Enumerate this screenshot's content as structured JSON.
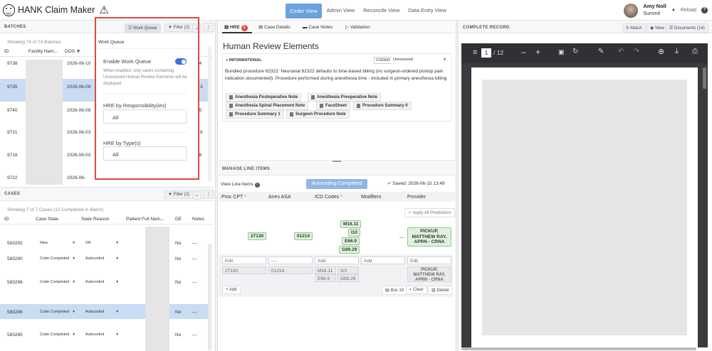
{
  "app": {
    "title": "HANK Claim Maker"
  },
  "nav": {
    "coder": "Coder View",
    "admin": "Admin View",
    "reconcile": "Reconcile View",
    "data_entry": "Data Entry View"
  },
  "user": {
    "name": "Amy Noll",
    "org": "Summit",
    "reload": "Reload",
    "help": "?"
  },
  "batches": {
    "header": "BATCHES",
    "work_queue_btn": "Work Queue",
    "filter_btn": "Filter (2)",
    "showing": "Showing 74 of 74 Batches",
    "columns": [
      "ID",
      "Facility Nam...",
      "DOS"
    ],
    "rows": [
      {
        "id": "9738",
        "dos": "2026-06-10",
        "side": "04"
      },
      {
        "id": "9735",
        "dos": "2026-06-09",
        "side": "3"
      },
      {
        "id": "9740",
        "dos": "2026-06-09",
        "side": "05"
      },
      {
        "id": "9721",
        "dos": "2026-06-03",
        "side": "8"
      },
      {
        "id": "9718",
        "dos": "2026-06-03",
        "side": "08"
      },
      {
        "id": "9722",
        "dos": "2026-06-",
        "side": ""
      }
    ]
  },
  "work_queue": {
    "title": "Work Queue",
    "enable_label": "Enable Work Queue",
    "description": "When enabled, only cases containing Unresolved Human Review Elements will be displayed",
    "resp_label": "HRE by Responsibility(ies)",
    "resp_value": "All",
    "type_label": "HRE by Type(s)",
    "type_value": "All"
  },
  "cases": {
    "header": "CASES",
    "filter_btn": "Filter (2)",
    "showing": "Showing 7 of 7 Cases (12 Completed in Batch)",
    "columns": [
      "ID",
      "Case State",
      "State Reason",
      "Patient Full Nam...",
      "DE",
      "Notes"
    ],
    "rows": [
      {
        "id": "583292",
        "state": "New",
        "reason": "OK",
        "de": "No",
        "notes": "---"
      },
      {
        "id": "583290",
        "state": "Code Completed",
        "reason": "Autocoded",
        "de": "No",
        "notes": "---"
      },
      {
        "id": "583296",
        "state": "Code Completed",
        "reason": "Autocoded",
        "de": "No",
        "notes": "---"
      },
      {
        "id": "583286",
        "state": "Code Completed",
        "reason": "Autocoded",
        "de": "No",
        "notes": "---"
      },
      {
        "id": "583285",
        "state": "Code Completed",
        "reason": "Autocoded",
        "de": "No",
        "notes": "---"
      }
    ]
  },
  "hre": {
    "tabs": {
      "hre": "HRE",
      "hre_badge": "1",
      "case_details": "Case Details",
      "case_notes": "Case Notes",
      "validation": "Validation"
    },
    "title": "Human Review Elements",
    "item": {
      "level": "INFORMATIONAL",
      "coder_tag": "CODER",
      "status": "Unresolved",
      "text": "Bundled procedure 62322: Neuraxial 62322 defaults to time-based billing (no surgeon-ordered postop pain indication documented). Procedure performed during anesthesia time - included in primary anesthesia billing",
      "docs": [
        "Anesthesia Postoperative Note",
        "Anesthesia Preoperative Note",
        "Anesthesia Spinal Placement Note",
        "FaceSheet",
        "Procedure Summary 0",
        "Procedure Summary 1",
        "Surgeon Procedure Note"
      ]
    }
  },
  "line_items": {
    "header": "MANAGE LINE ITEMS",
    "view_label": "View Line Items",
    "status_btn": "Autocoding Completed",
    "saved": "Saved: 2026-06-15 13:49",
    "columns": [
      "Proc CPT",
      "Anes ASA",
      "ICD Codes",
      "Modifiers",
      "Provider"
    ],
    "apply_btn": "Apply All Predictions",
    "prediction": {
      "cpt": "27130",
      "asa": "01214",
      "icd": [
        "M16.11",
        "I10",
        "E66.9",
        "G89.29"
      ],
      "mod": "---",
      "provider": "PICKUP, MATTHEW RAY, APRN - CRNA"
    },
    "edit_row": {
      "cpt": "Edit",
      "asa": "----",
      "icd": "Add",
      "mod": "Add",
      "provider": "Edit"
    },
    "current": {
      "cpt": "27130",
      "asa": "01214",
      "icd": [
        "M16.11",
        "I10",
        "E66.9",
        "G89.29"
      ],
      "provider": "PICKUP, MATTHEW RAY, APRN - CRNA"
    },
    "add_btn": "+ Add",
    "box19_btn": "Box 19",
    "clear_btn": "Clear",
    "delete_btn": "Delete"
  },
  "record": {
    "header": "COMPLETE RECORD",
    "attach": "Attach",
    "view": "View",
    "documents": "Documents (14)",
    "page": "1",
    "pages": "/ 12"
  }
}
